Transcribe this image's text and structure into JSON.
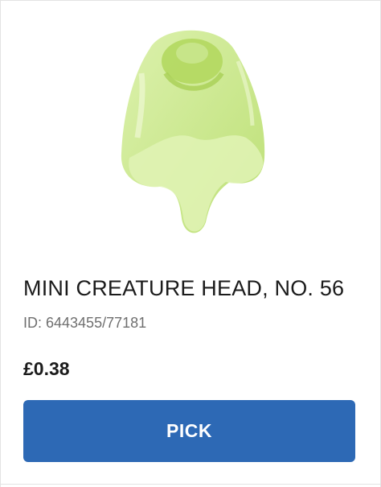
{
  "product": {
    "image_name": "creature-head-image",
    "name": "MINI CREATURE HEAD, NO. 56",
    "id_label": "ID: 6443455/77181",
    "price": "£0.38",
    "pick_label": "PICK"
  },
  "colors": {
    "button": "#2d69b5",
    "button_text": "#ffffff",
    "title_text": "#1b1b1b",
    "id_text": "#6f6f6f",
    "part_color": "#c9e88a"
  }
}
